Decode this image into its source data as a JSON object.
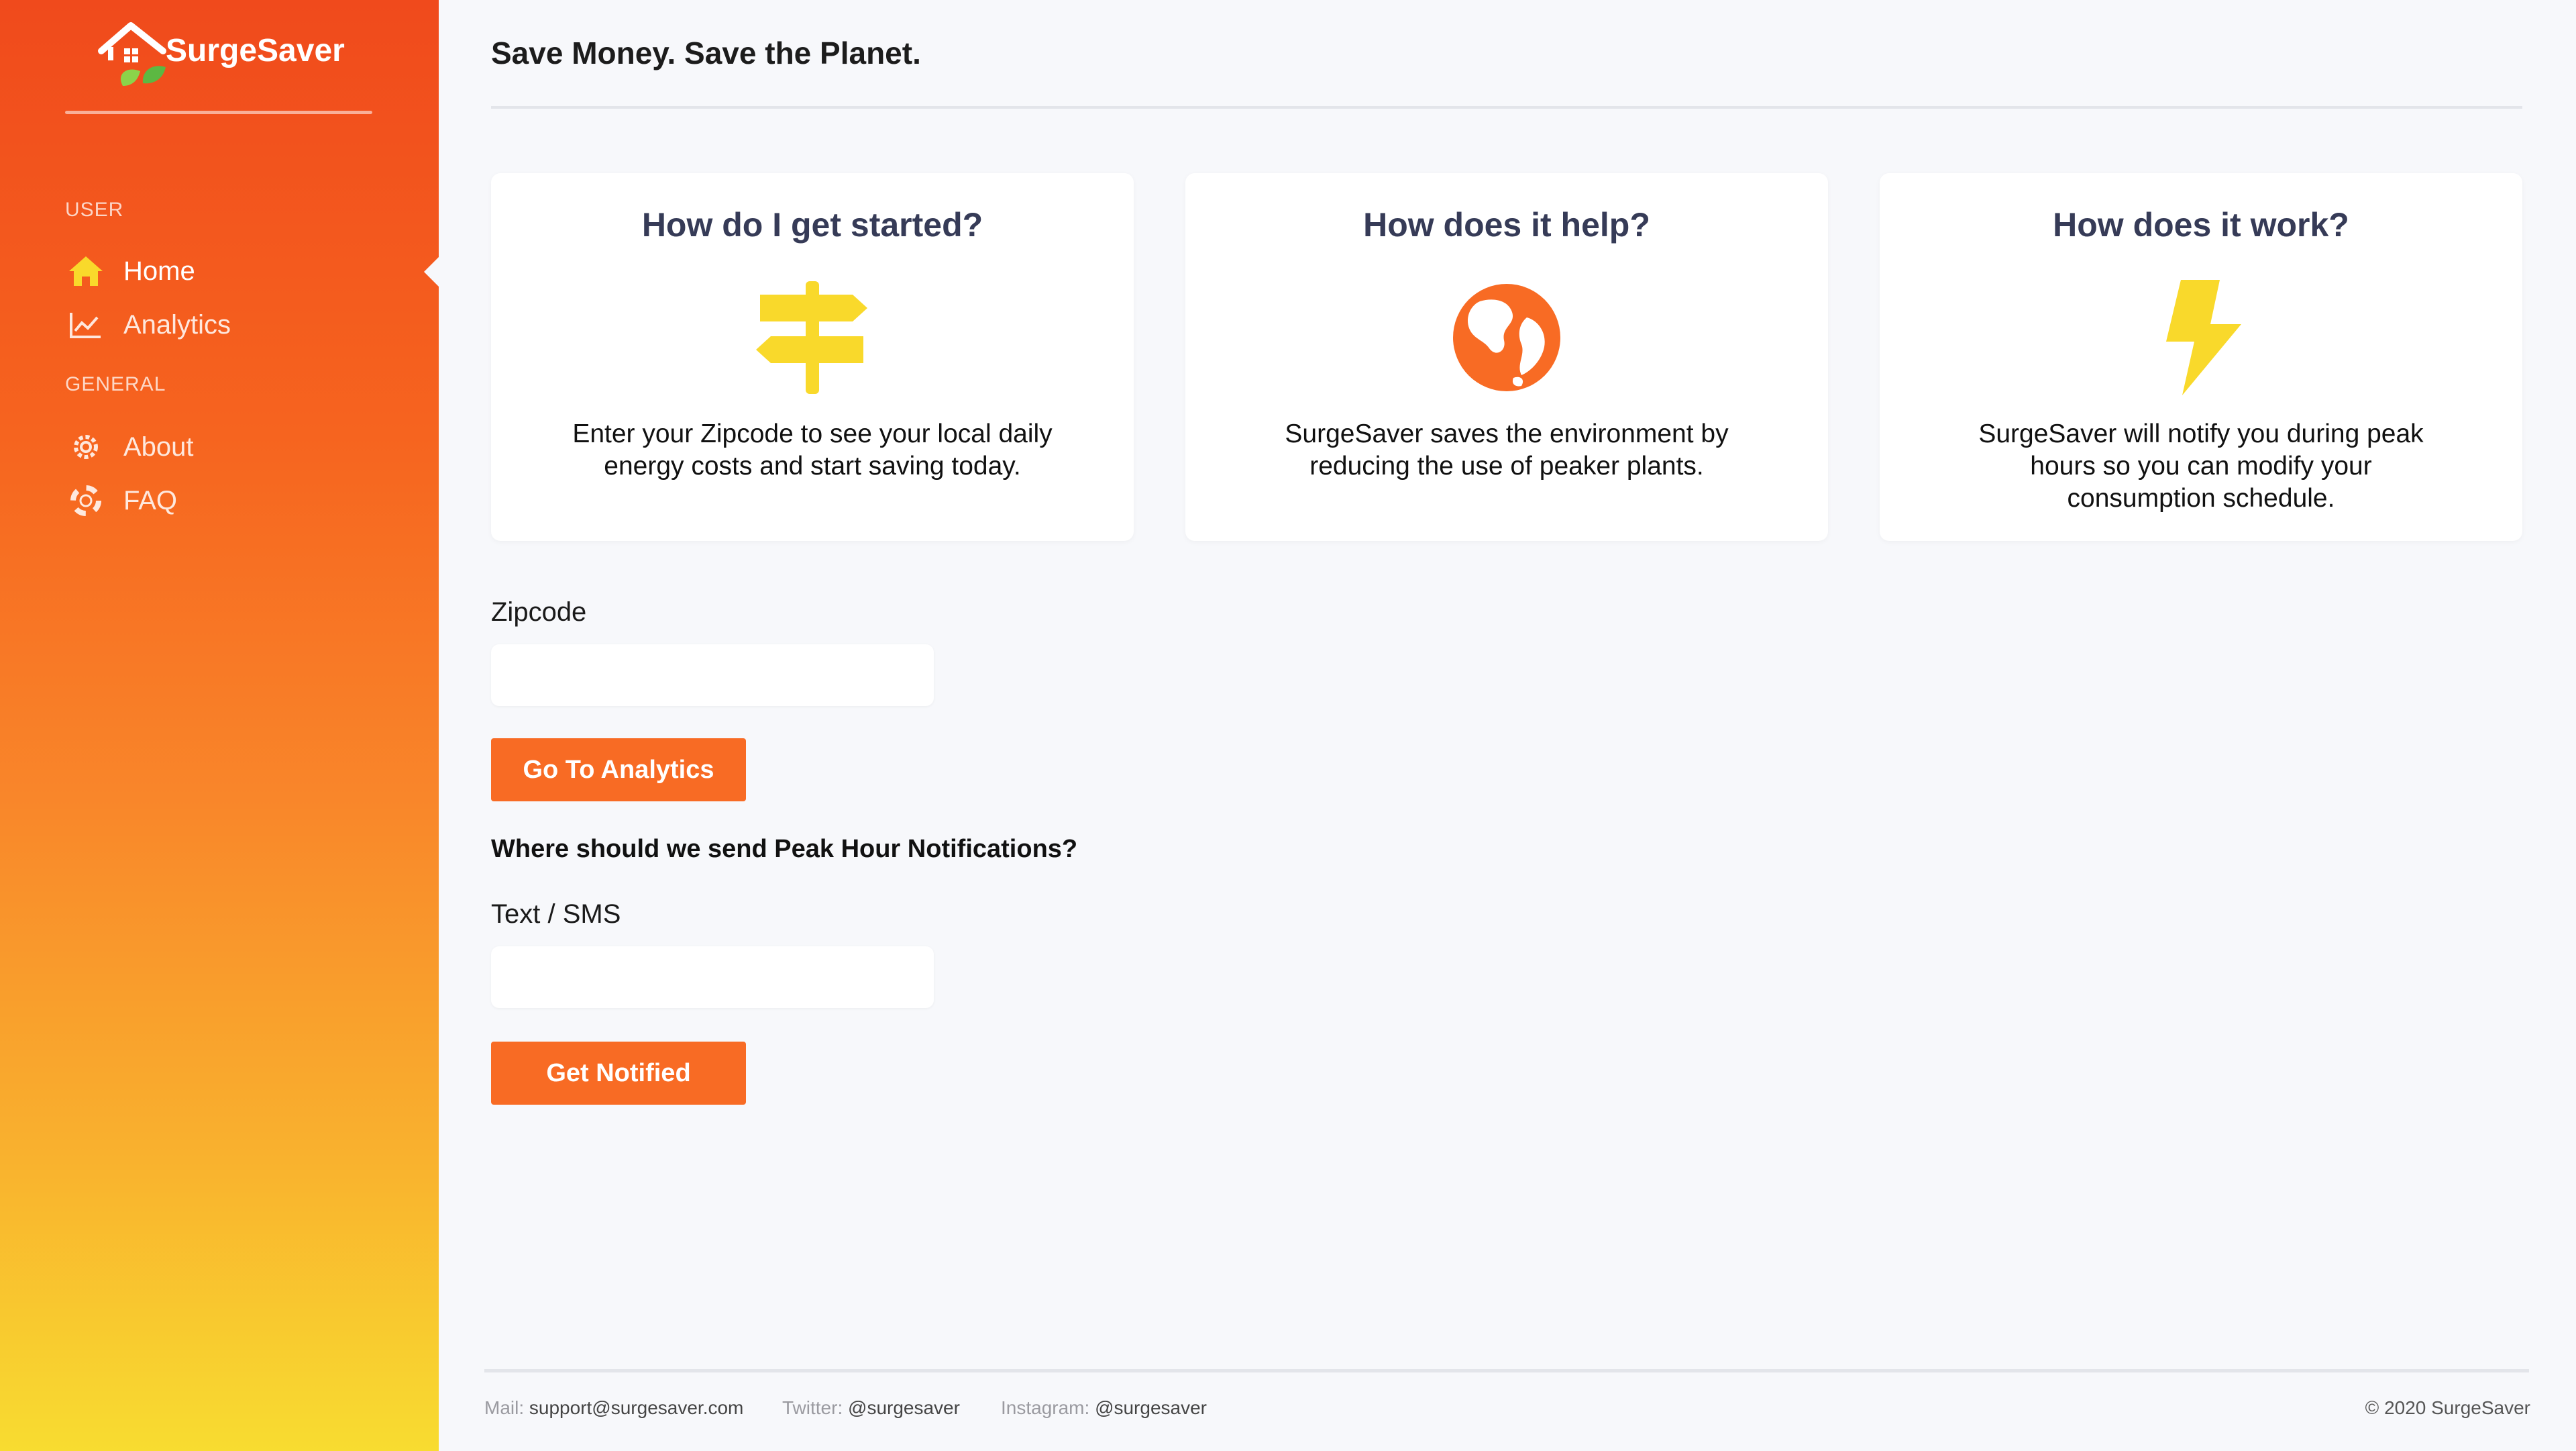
{
  "colors": {
    "accent": "#f86b24",
    "sidebar_top": "#f04a1c",
    "sidebar_bottom": "#f8dc30",
    "icon_yellow": "#f9d92b"
  },
  "app": {
    "name": "SurgeSaver"
  },
  "sidebar": {
    "sections": [
      {
        "label": "USER",
        "items": [
          {
            "label": "Home",
            "icon": "home-icon",
            "active": true
          },
          {
            "label": "Analytics",
            "icon": "chart-line-icon"
          }
        ]
      },
      {
        "label": "GENERAL",
        "items": [
          {
            "label": "About",
            "icon": "gear-icon"
          },
          {
            "label": "FAQ",
            "icon": "lifebuoy-icon"
          }
        ]
      }
    ]
  },
  "header": {
    "title": "Save Money. Save the Planet."
  },
  "cards": [
    {
      "title": "How do I get started?",
      "icon": "signpost-icon",
      "text": "Enter your Zipcode to see your local daily energy costs and start saving today."
    },
    {
      "title": "How does it help?",
      "icon": "globe-icon",
      "text": "SurgeSaver saves the environment by reducing the use of peaker plants."
    },
    {
      "title": "How does it work?",
      "icon": "lightning-icon",
      "text": "SurgeSaver will notify you during peak hours so you can modify your consumption schedule."
    }
  ],
  "zipcode": {
    "label": "Zipcode",
    "value": "",
    "button": "Go To Analytics"
  },
  "notifications": {
    "question": "Where should we send Peak Hour Notifications?",
    "label": "Text / SMS",
    "value": "",
    "button": "Get Notified"
  },
  "footer": {
    "mail_label": "Mail:",
    "mail": "support@surgesaver.com",
    "twitter_label": "Twitter:",
    "twitter": "@surgesaver",
    "instagram_label": "Instagram:",
    "instagram": "@surgesaver",
    "copyright": "© 2020 SurgeSaver"
  }
}
